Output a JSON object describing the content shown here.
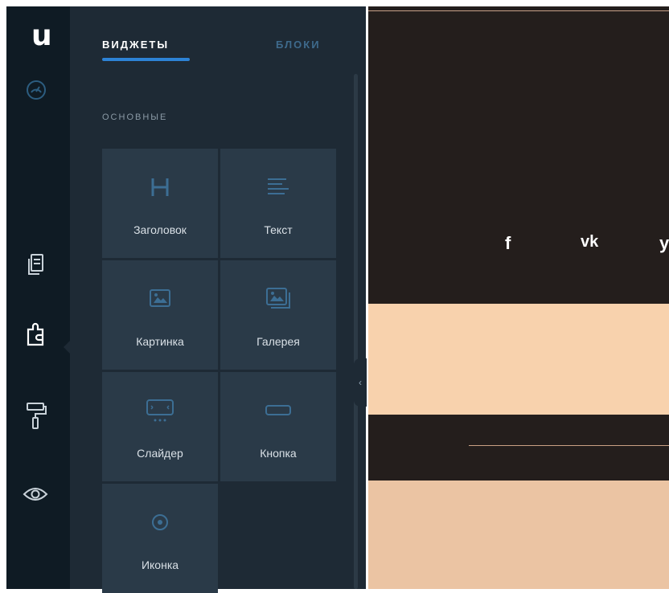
{
  "app": {
    "logo_text": "u"
  },
  "rail": {
    "items": [
      {
        "id": "dashboard",
        "icon": "speedometer-icon"
      },
      {
        "id": "pages",
        "icon": "pages-icon"
      },
      {
        "id": "widgets",
        "icon": "puzzle-icon",
        "active": true
      },
      {
        "id": "design",
        "icon": "paint-roller-icon"
      },
      {
        "id": "preview",
        "icon": "eye-icon"
      }
    ]
  },
  "panel": {
    "tabs": [
      {
        "label": "ВИДЖЕТЫ",
        "active": true
      },
      {
        "label": "БЛОКИ",
        "active": false
      }
    ],
    "section_title": "ОСНОВНЫЕ",
    "widgets": [
      {
        "label": "Заголовок",
        "icon": "heading-icon"
      },
      {
        "label": "Текст",
        "icon": "text-icon"
      },
      {
        "label": "Картинка",
        "icon": "image-icon"
      },
      {
        "label": "Галерея",
        "icon": "gallery-icon"
      },
      {
        "label": "Слайдер",
        "icon": "slider-icon"
      },
      {
        "label": "Кнопка",
        "icon": "button-icon"
      },
      {
        "label": "Иконка",
        "icon": "icon-widget-icon"
      }
    ],
    "collapse_glyph": "‹"
  },
  "canvas": {
    "social": [
      {
        "label": "f",
        "icon": "facebook-icon"
      },
      {
        "label": "vk",
        "icon": "vk-icon"
      },
      {
        "label": "y",
        "icon": "twitter-icon"
      }
    ]
  },
  "colors": {
    "rail_bg": "#0f1b24",
    "panel_bg": "#1e2a35",
    "card_bg": "#2a3a48",
    "accent": "#2d83d6",
    "icon_blue": "#3c6e94",
    "canvas_dark": "#241e1c",
    "canvas_peach": "#f8d2ad",
    "canvas_peach_2": "#ebc4a3"
  }
}
